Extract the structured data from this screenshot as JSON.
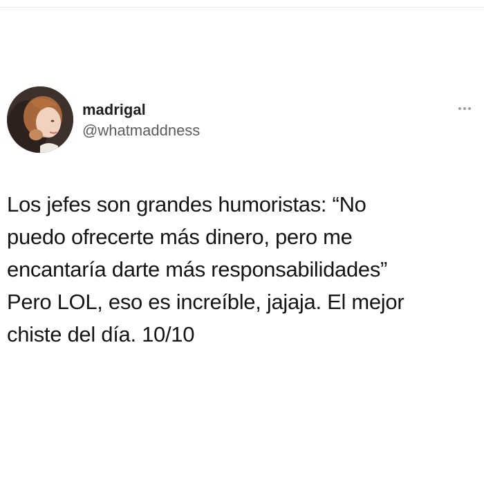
{
  "tweet": {
    "author": {
      "display_name": "madrigal",
      "handle": "@whatmaddness",
      "avatar_icon": "profile-photo"
    },
    "more_icon": "ellipsis-icon",
    "text": "Los jefes son grandes humoristas: “No\npuedo ofrecerte más dinero, pero me\nencantaría darte más responsabilidades”\nPero LOL, eso es increíble, jajaja. El mejor\nchiste del día. 10/10"
  },
  "colors": {
    "background": "#ffffff",
    "text": "#141414",
    "secondary_text": "#5c5c5c"
  }
}
